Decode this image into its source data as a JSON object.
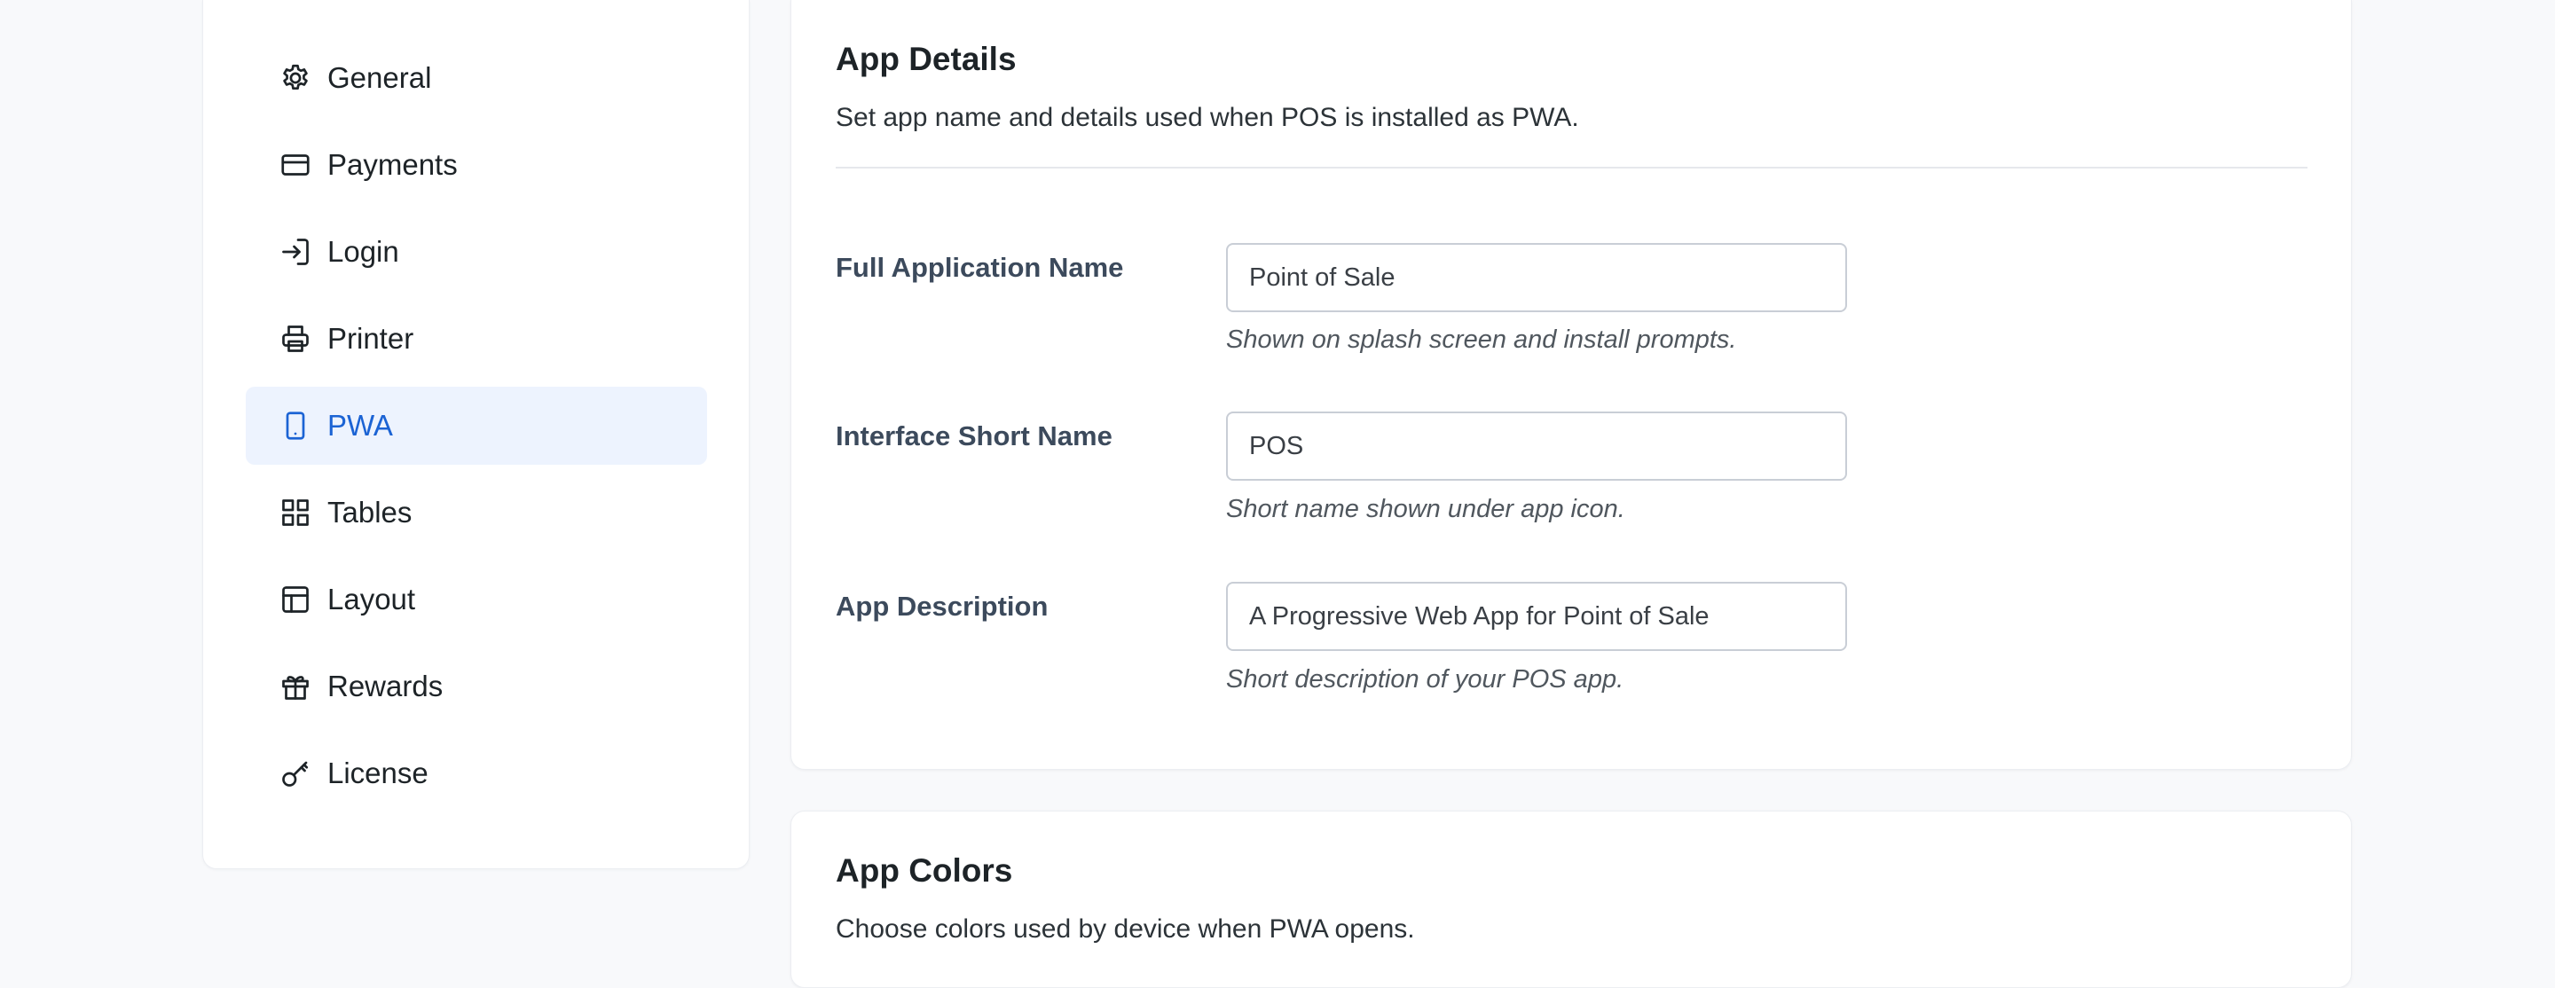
{
  "sidebar": {
    "items": [
      {
        "label": "General",
        "icon": "gear-icon",
        "active": false
      },
      {
        "label": "Payments",
        "icon": "credit-card-icon",
        "active": false
      },
      {
        "label": "Login",
        "icon": "login-icon",
        "active": false
      },
      {
        "label": "Printer",
        "icon": "printer-icon",
        "active": false
      },
      {
        "label": "PWA",
        "icon": "smartphone-icon",
        "active": true
      },
      {
        "label": "Tables",
        "icon": "grid-icon",
        "active": false
      },
      {
        "label": "Layout",
        "icon": "layout-icon",
        "active": false
      },
      {
        "label": "Rewards",
        "icon": "gift-icon",
        "active": false
      },
      {
        "label": "License",
        "icon": "key-icon",
        "active": false
      }
    ]
  },
  "app_details": {
    "title": "App Details",
    "description": "Set app name and details used when POS is installed as PWA.",
    "fields": [
      {
        "label": "Full Application Name",
        "value": "Point of Sale",
        "help": "Shown on splash screen and install prompts."
      },
      {
        "label": "Interface Short Name",
        "value": "POS",
        "help": "Short name shown under app icon."
      },
      {
        "label": "App Description",
        "value": "A Progressive Web App for Point of Sale",
        "help": "Short description of your POS app."
      }
    ]
  },
  "app_colors": {
    "title": "App Colors",
    "description": "Choose colors used by device when PWA opens."
  },
  "colors": {
    "accent": "#1b63d4",
    "active_bg": "#edf3fe",
    "page_bg": "#f8f9fb"
  }
}
